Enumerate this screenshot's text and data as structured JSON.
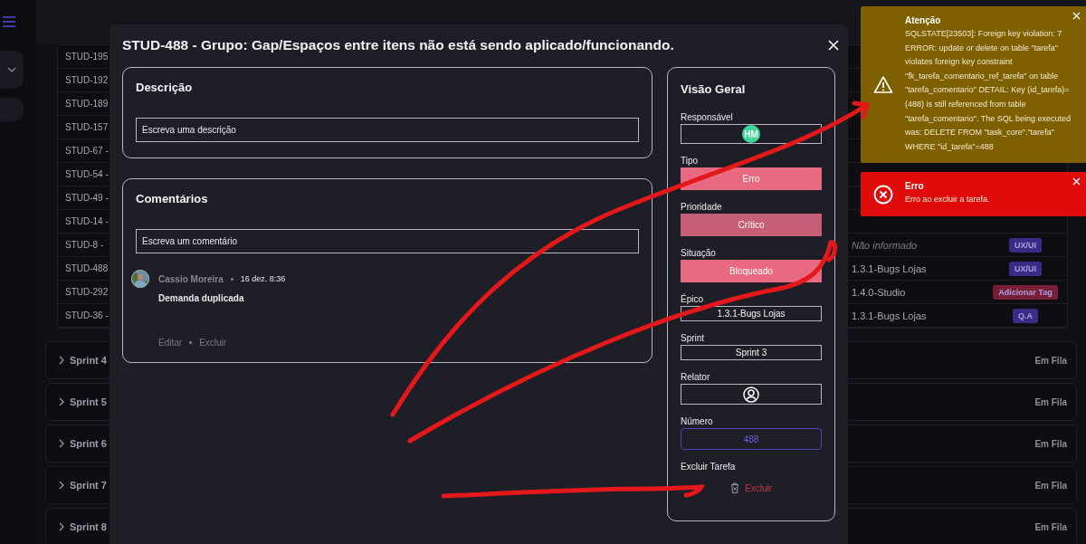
{
  "board": {
    "rows": [
      {
        "id": "STUD-195"
      },
      {
        "id": "STUD-192"
      },
      {
        "id": "STUD-189"
      },
      {
        "id": "STUD-157"
      },
      {
        "id": "STUD-67 -"
      },
      {
        "id": "STUD-54 -"
      },
      {
        "id": "STUD-49 -"
      },
      {
        "id": "STUD-14 -"
      },
      {
        "id": "STUD-8 -",
        "epic": {
          "text": "Não informado",
          "kind": "empty"
        },
        "tag": {
          "label": "UX/UI",
          "color": "#3a2c86"
        }
      },
      {
        "id": "STUD-488",
        "epic": {
          "text": "1.3.1-Bugs Lojas",
          "kind": "value"
        },
        "tag": {
          "label": "UX/UI",
          "color": "#3a2c86"
        }
      },
      {
        "id": "STUD-292",
        "epic": {
          "text": "1.4.0-Studio",
          "kind": "value"
        },
        "tag": {
          "label": "Adicionar Tag",
          "color": "#7a1e38"
        }
      },
      {
        "id": "STUD-36 -",
        "epic": {
          "text": "1.3.1-Bugs Lojas",
          "kind": "value"
        },
        "tag": {
          "label": "Q.A",
          "color": "#3a2c86"
        }
      }
    ],
    "sprints": [
      {
        "name": "Sprint 4",
        "status": "Em Fila"
      },
      {
        "name": "Sprint 5",
        "status": "Em Fila"
      },
      {
        "name": "Sprint 6",
        "status": "Em Fila"
      },
      {
        "name": "Sprint 7",
        "status": "Em Fila"
      },
      {
        "name": "Sprint 8",
        "status": "Em Fila"
      }
    ]
  },
  "modal": {
    "title": "STUD-488 - Grupo: Gap/Espaços entre itens não está sendo aplicado/funcionando.",
    "description": {
      "heading": "Descrição",
      "placeholder": "Escreva uma descrição"
    },
    "comments": {
      "heading": "Comentários",
      "placeholder": "Escreva um comentário",
      "items": [
        {
          "author": "Cassio Moreira",
          "time": "16 dez. 8:36",
          "text": "Demanda duplicada",
          "actions": [
            "Editar",
            "Excluir"
          ]
        }
      ]
    },
    "overview": {
      "heading": "Visão Geral",
      "fields": [
        {
          "label": "Responsável",
          "kind": "avatar",
          "value": "HM"
        },
        {
          "label": "Tipo",
          "kind": "pill",
          "value": "Erro",
          "color": "#e86a80"
        },
        {
          "label": "Prioridade",
          "kind": "pill",
          "value": "Crítico",
          "color": "#c75e77"
        },
        {
          "label": "Situação",
          "kind": "pill",
          "value": "Bloqueado",
          "color": "#e86a80"
        },
        {
          "label": "Épico",
          "kind": "text",
          "value": "1.3.1-Bugs Lojas"
        },
        {
          "label": "Sprint",
          "kind": "text",
          "value": "Sprint 3"
        },
        {
          "label": "Relator",
          "kind": "user"
        },
        {
          "label": "Número",
          "kind": "number",
          "value": "488"
        },
        {
          "label": "Excluir Tarefa",
          "kind": "delete",
          "value": "Excluir"
        }
      ]
    }
  },
  "toasts": [
    {
      "kind": "warning",
      "title": "Atenção",
      "message": "SQLSTATE[23503]: Foreign key violation: 7 ERROR: update or delete on table \"tarefa\" violates foreign key constraint \"fk_tarefa_comentario_ref_tarefa\" on table \"tarefa_comentario\" DETAIL: Key (id_tarefa)=(488) is still referenced from table \"tarefa_comentario\". The SQL being executed was: DELETE FROM \"task_core\".\"tarefa\" WHERE \"id_tarefa\"=488"
    },
    {
      "kind": "error",
      "title": "Erro",
      "message": "Erro ao excluir a tarefa."
    }
  ]
}
